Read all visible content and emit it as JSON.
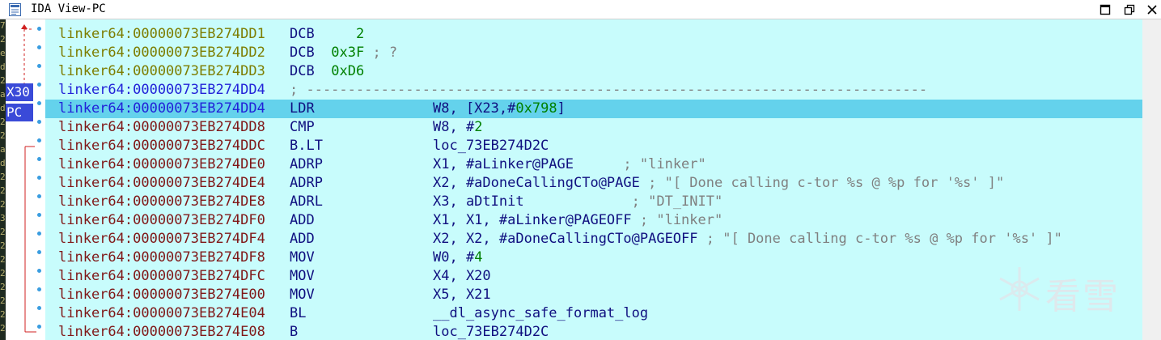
{
  "window": {
    "title": "IDA View-PC",
    "buttons": [
      "maximize",
      "restore",
      "close"
    ]
  },
  "registers": [
    {
      "label": "X30",
      "row": 4
    },
    {
      "label": "PC",
      "row": 5
    }
  ],
  "left_strip_chars": [
    "7",
    "2",
    "e",
    "d",
    "2",
    "a",
    "d",
    "2",
    "2",
    "a",
    "d",
    "2",
    "2",
    "2",
    "3",
    "2",
    "2",
    "2",
    "2",
    "2",
    "2",
    "2",
    "2"
  ],
  "current_row": 4,
  "colors": {
    "listing_bg": "#c8fcfc",
    "current_line_bg": "#64d2ec",
    "data_address": "#7d7d00",
    "code_address": "#801818",
    "separator_address": "#2222d8",
    "number": "#008000",
    "comment": "#808080",
    "register_label_bg": "#3a4ad8"
  },
  "lines": [
    {
      "address": "linker64:00000073EB274DD1",
      "mnemonic": "DCB",
      "operands": "    2",
      "comment": "",
      "kind": "data"
    },
    {
      "address": "linker64:00000073EB274DD2",
      "mnemonic": "DCB",
      "operands": " 0x3F",
      "comment": " ; ?",
      "kind": "data"
    },
    {
      "address": "linker64:00000073EB274DD3",
      "mnemonic": "DCB",
      "operands": " 0xD6",
      "comment": "",
      "kind": "data"
    },
    {
      "address": "linker64:00000073EB274DD4",
      "mnemonic": "",
      "operands": "",
      "comment": "; ---------------------------------------------------------------------------",
      "kind": "separator"
    },
    {
      "address": "linker64:00000073EB274DD4",
      "mnemonic": "LDR",
      "operands": "W8, [X23,#0x798]",
      "comment": "",
      "kind": "code"
    },
    {
      "address": "linker64:00000073EB274DD8",
      "mnemonic": "CMP",
      "operands": "W8, #2",
      "comment": "",
      "kind": "code"
    },
    {
      "address": "linker64:00000073EB274DDC",
      "mnemonic": "B.LT",
      "operands": "loc_73EB274D2C",
      "comment": "",
      "kind": "code"
    },
    {
      "address": "linker64:00000073EB274DE0",
      "mnemonic": "ADRP",
      "operands": "X1, #aLinker@PAGE      ",
      "comment": "; \"linker\"",
      "kind": "code"
    },
    {
      "address": "linker64:00000073EB274DE4",
      "mnemonic": "ADRP",
      "operands": "X2, #aDoneCallingCTo@PAGE ",
      "comment": "; \"[ Done calling c-tor %s @ %p for '%s' ]\"",
      "kind": "code"
    },
    {
      "address": "linker64:00000073EB274DE8",
      "mnemonic": "ADRL",
      "operands": "X3, aDtInit             ",
      "comment": "; \"DT_INIT\"",
      "kind": "code"
    },
    {
      "address": "linker64:00000073EB274DF0",
      "mnemonic": "ADD",
      "operands": "X1, X1, #aLinker@PAGEOFF ",
      "comment": "; \"linker\"",
      "kind": "code"
    },
    {
      "address": "linker64:00000073EB274DF4",
      "mnemonic": "ADD",
      "operands": "X2, X2, #aDoneCallingCTo@PAGEOFF ",
      "comment": "; \"[ Done calling c-tor %s @ %p for '%s' ]\"",
      "kind": "code"
    },
    {
      "address": "linker64:00000073EB274DF8",
      "mnemonic": "MOV",
      "operands": "W0, #4",
      "comment": "",
      "kind": "code"
    },
    {
      "address": "linker64:00000073EB274DFC",
      "mnemonic": "MOV",
      "operands": "X4, X20",
      "comment": "",
      "kind": "code"
    },
    {
      "address": "linker64:00000073EB274E00",
      "mnemonic": "MOV",
      "operands": "X5, X21",
      "comment": "",
      "kind": "code"
    },
    {
      "address": "linker64:00000073EB274E04",
      "mnemonic": "BL",
      "operands": "__dl_async_safe_format_log",
      "comment": "",
      "kind": "code"
    },
    {
      "address": "linker64:00000073EB274E08",
      "mnemonic": "B",
      "operands": "loc_73EB274D2C",
      "comment": "",
      "kind": "code"
    }
  ],
  "watermark": {
    "text": "看雪"
  }
}
